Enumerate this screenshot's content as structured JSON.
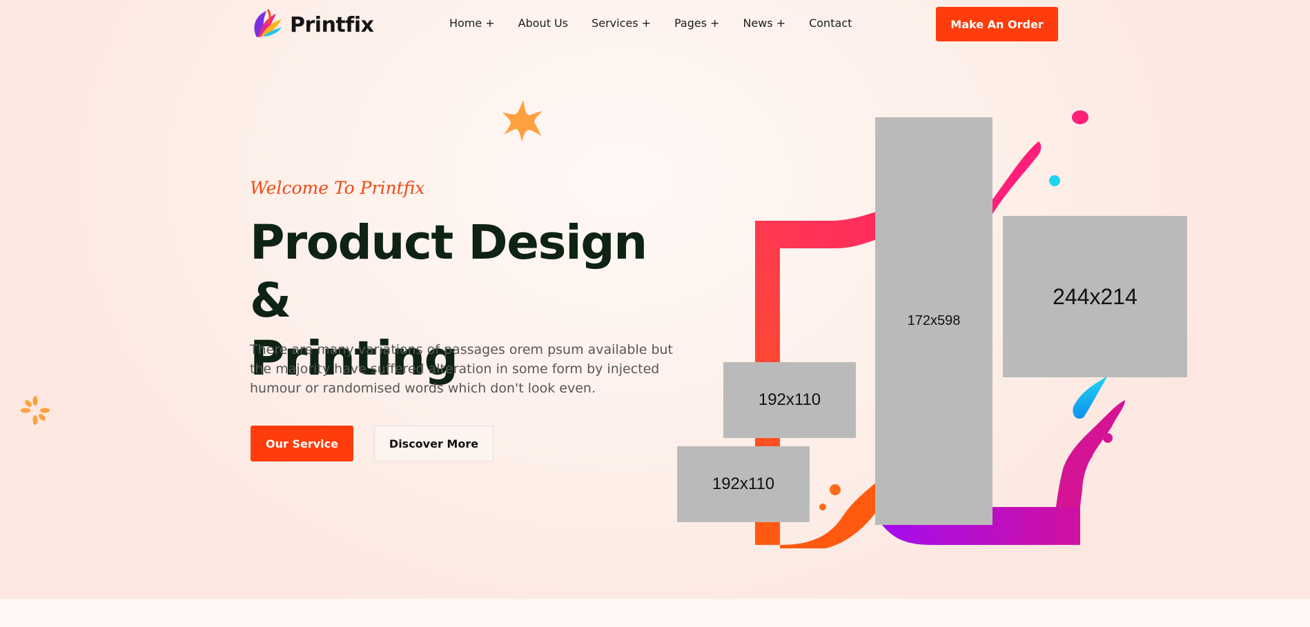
{
  "brand": {
    "name": "Printfix",
    "logo_icon": "feather-logo-icon"
  },
  "nav": {
    "items": [
      {
        "label": "Home",
        "suffix": "+"
      },
      {
        "label": "About Us",
        "suffix": ""
      },
      {
        "label": "Services",
        "suffix": "+"
      },
      {
        "label": "Pages",
        "suffix": "+"
      },
      {
        "label": "News",
        "suffix": "+"
      },
      {
        "label": "Contact",
        "suffix": ""
      }
    ],
    "cta_label": "Make An Order"
  },
  "hero": {
    "subtitle": "Welcome To Printfix",
    "title_line1": "Product Design &",
    "title_line2": "Printing",
    "description": "There are many variations of passages orem psum available but the majority have suffered alteration in some form by injected humour or randomised words which don't look even.",
    "primary_button": "Our Service",
    "secondary_button": "Discover More"
  },
  "images": {
    "tall": "172x598",
    "wide": "244x214",
    "small_top": "192x110",
    "small_bottom": "192x110"
  },
  "colors": {
    "accent": "#ff3c0b",
    "heading": "#0e2312",
    "subtitle": "#f04a14",
    "placeholder": "#bababa",
    "star": "#ffa040"
  }
}
